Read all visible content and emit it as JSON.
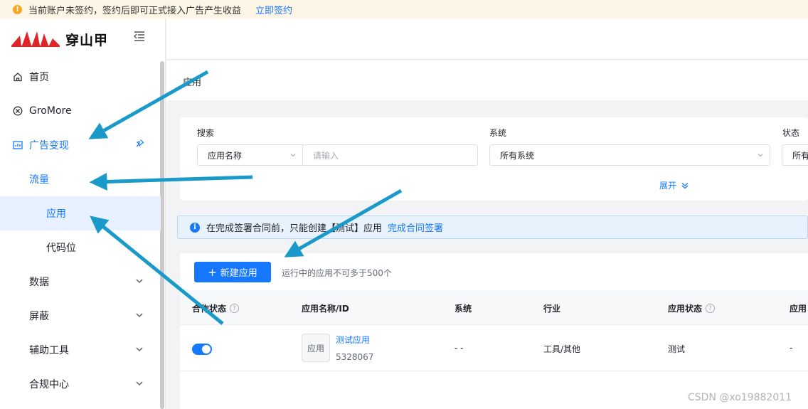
{
  "notice": {
    "icon": "warning-icon",
    "text": "当前账户未签约，签约后即可正式接入广告产生收益",
    "link": "立即签约"
  },
  "logo": {
    "brand": "穿山甲",
    "mark": "pangolin-logo"
  },
  "sidebar": {
    "collapse_icon": "menu-fold-icon",
    "items": [
      {
        "label": "首页",
        "icon": "home-icon"
      },
      {
        "label": "GroMore",
        "icon": "gromore-icon"
      },
      {
        "label": "广告变现",
        "icon": "chart-icon",
        "pin_icon": "pin-icon"
      },
      {
        "label": "流量"
      },
      {
        "label": "应用"
      },
      {
        "label": "代码位"
      },
      {
        "label": "数据",
        "chevron": "chevron-down-icon"
      },
      {
        "label": "屏蔽",
        "chevron": "chevron-down-icon"
      },
      {
        "label": "辅助工具",
        "chevron": "chevron-down-icon"
      },
      {
        "label": "合规中心",
        "chevron": "chevron-down-icon"
      }
    ]
  },
  "page": {
    "title": "应用"
  },
  "filters": {
    "search_label": "搜索",
    "search_type": "应用名称",
    "search_placeholder": "请输入",
    "system_label": "系统",
    "system_value": "所有系统",
    "status_label": "状态",
    "status_value": "所有",
    "expand_label": "展开"
  },
  "info_bar": {
    "text": "在完成签署合同前，只能创建【测试】应用",
    "link": "完成合同签署"
  },
  "toolbar": {
    "new_button": "新建应用",
    "hint": "运行中的应用不可多于500个"
  },
  "table": {
    "columns": [
      "合作状态",
      "应用名称/ID",
      "系统",
      "行业",
      "应用状态",
      "应用"
    ],
    "rows": [
      {
        "enabled": true,
        "icon_text": "应用",
        "name": "测试应用",
        "id": "5328067",
        "system": "- -",
        "industry": "工具/其他",
        "status": "测试",
        "extra": "-"
      }
    ]
  },
  "watermark": "CSDN @xo19882011",
  "colors": {
    "accent": "#1677ff",
    "annotation_arrow": "#1a9ac9",
    "notice_bg": "#fdf6e7"
  }
}
